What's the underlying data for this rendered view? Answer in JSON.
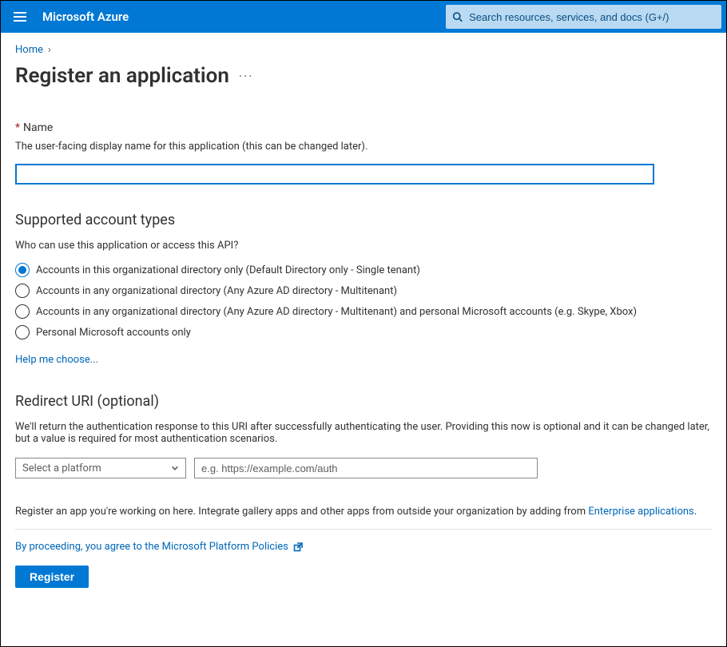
{
  "topbar": {
    "brand": "Microsoft Azure",
    "search_placeholder": "Search resources, services, and docs (G+/)"
  },
  "breadcrumb": {
    "home": "Home"
  },
  "page": {
    "title": "Register an application"
  },
  "name": {
    "label": "Name",
    "desc": "The user-facing display name for this application (this can be changed later).",
    "value": ""
  },
  "accounts": {
    "title": "Supported account types",
    "desc": "Who can use this application or access this API?",
    "options": [
      "Accounts in this organizational directory only (Default Directory only - Single tenant)",
      "Accounts in any organizational directory (Any Azure AD directory - Multitenant)",
      "Accounts in any organizational directory (Any Azure AD directory - Multitenant) and personal Microsoft accounts (e.g. Skype, Xbox)",
      "Personal Microsoft accounts only"
    ],
    "selected_index": 0,
    "help_link": "Help me choose..."
  },
  "redirect": {
    "title": "Redirect URI (optional)",
    "desc": "We'll return the authentication response to this URI after successfully authenticating the user. Providing this now is optional and it can be changed later, but a value is required for most authentication scenarios.",
    "platform_placeholder": "Select a platform",
    "uri_placeholder": "e.g. https://example.com/auth"
  },
  "note": {
    "prefix": "Register an app you're working on here. Integrate gallery apps and other apps from outside your organization by adding from ",
    "link": "Enterprise applications",
    "suffix": "."
  },
  "footer": {
    "agree": "By proceeding, you agree to the Microsoft Platform Policies",
    "register": "Register"
  }
}
